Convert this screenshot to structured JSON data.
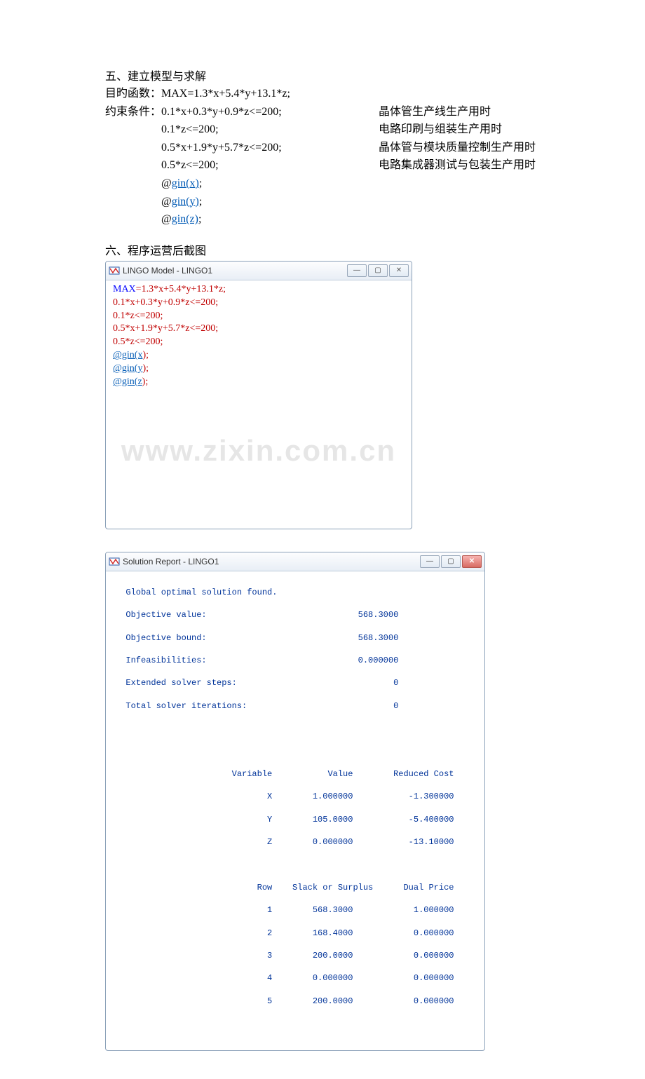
{
  "section5": {
    "title": "五、建立模型与求解",
    "objective_label": "目旳函数：",
    "objective_code": "MAX=1.3*x+5.4*y+13.1*z;",
    "constraint_label": "约束条件：",
    "constraints": [
      {
        "code": "0.1*x+0.3*y+0.9*z<=200;",
        "note": "晶体管生产线生产用时"
      },
      {
        "code": "0.1*z<=200;",
        "note": "电路印刷与组装生产用时"
      },
      {
        "code": "0.5*x+1.9*y+5.7*z<=200;",
        "note": "晶体管与模块质量控制生产用时"
      },
      {
        "code": "0.5*z<=200;",
        "note": "电路集成器测试与包装生产用时"
      }
    ],
    "gins": [
      {
        "at": "@",
        "fn": "gin(x)",
        "tail": ";"
      },
      {
        "at": "@",
        "fn": "gin(y)",
        "tail": ";"
      },
      {
        "at": "@",
        "fn": "gin(z)",
        "tail": ";"
      }
    ]
  },
  "section6": {
    "title": "六、程序运营后截图"
  },
  "model_window": {
    "title": "LINGO Model - LINGO1",
    "lines": [
      {
        "type": "max",
        "left": "MAX",
        "rest": "=1.3*x+5.4*y+13.1*z;"
      },
      {
        "type": "plain",
        "text": "0.1*x+0.3*y+0.9*z<=200;"
      },
      {
        "type": "plain",
        "text": "0.1*z<=200;"
      },
      {
        "type": "plain",
        "text": "0.5*x+1.9*y+5.7*z<=200;"
      },
      {
        "type": "plain",
        "text": "0.5*z<=200;"
      },
      {
        "type": "gin",
        "link": "@gin(x",
        "tail": ");"
      },
      {
        "type": "gin",
        "link": "@gin(y",
        "tail": ");"
      },
      {
        "type": "gin",
        "link": "@gin(z",
        "tail": ");"
      }
    ],
    "watermark": "www.zixin.com.cn"
  },
  "report_window": {
    "title": "Solution Report - LINGO1",
    "header": [
      "  Global optimal solution found.",
      "  Objective value:                              568.3000",
      "  Objective bound:                              568.3000",
      "  Infeasibilities:                              0.000000",
      "  Extended solver steps:                               0",
      "  Total solver iterations:                             0"
    ],
    "var_header": "                       Variable           Value        Reduced Cost",
    "vars": [
      "                              X        1.000000           -1.300000",
      "                              Y        105.0000           -5.400000",
      "                              Z        0.000000           -13.10000"
    ],
    "row_header": "                            Row    Slack or Surplus      Dual Price",
    "rows": [
      "                              1        568.3000            1.000000",
      "                              2        168.4000            0.000000",
      "                              3        200.0000            0.000000",
      "                              4        0.000000            0.000000",
      "                              5        200.0000            0.000000"
    ]
  },
  "chart_data": {
    "type": "table",
    "title": "LINGO Solution Report",
    "summary": {
      "Objective value": 568.3,
      "Objective bound": 568.3,
      "Infeasibilities": 0.0,
      "Extended solver steps": 0,
      "Total solver iterations": 0
    },
    "variables": [
      {
        "Variable": "X",
        "Value": 1.0,
        "Reduced Cost": -1.3
      },
      {
        "Variable": "Y",
        "Value": 105.0,
        "Reduced Cost": -5.4
      },
      {
        "Variable": "Z",
        "Value": 0.0,
        "Reduced Cost": -13.1
      }
    ],
    "rows": [
      {
        "Row": 1,
        "Slack or Surplus": 568.3,
        "Dual Price": 1.0
      },
      {
        "Row": 2,
        "Slack or Surplus": 168.4,
        "Dual Price": 0.0
      },
      {
        "Row": 3,
        "Slack or Surplus": 200.0,
        "Dual Price": 0.0
      },
      {
        "Row": 4,
        "Slack or Surplus": 0.0,
        "Dual Price": 0.0
      },
      {
        "Row": 5,
        "Slack or Surplus": 200.0,
        "Dual Price": 0.0
      }
    ]
  },
  "glyph": {
    "min": "—",
    "max": "▢",
    "close": "✕"
  }
}
